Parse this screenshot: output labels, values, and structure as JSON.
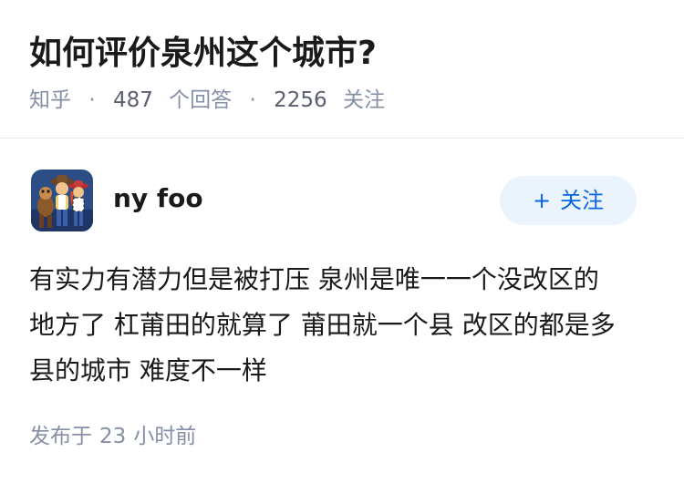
{
  "question": {
    "title": "如何评价泉州这个城市?",
    "source": "知乎",
    "answers_count": "487",
    "answers_label": "个回答",
    "followers_count": "2256",
    "followers_label": "关注"
  },
  "answer": {
    "author": {
      "name": "ny foo",
      "follow_button_label": "关注",
      "follow_icon": "+"
    },
    "content_lines": [
      "有实力有潜力但是被打压 泉州是唯一一个没改区的",
      "地方了 杠莆田的就算了 莆田就一个县 改区的都是多",
      "县的城市 难度不一样"
    ],
    "published": {
      "prefix": "发布于",
      "number": "23",
      "unit": "小时前"
    }
  },
  "colors": {
    "title": "#1a1a1a",
    "meta": "#8590a6",
    "accent": "#0a66e0",
    "follow_bg": "#ebf3fd"
  },
  "icons": {
    "avatar": "cartoon-characters-avatar",
    "follow": "plus-icon"
  }
}
